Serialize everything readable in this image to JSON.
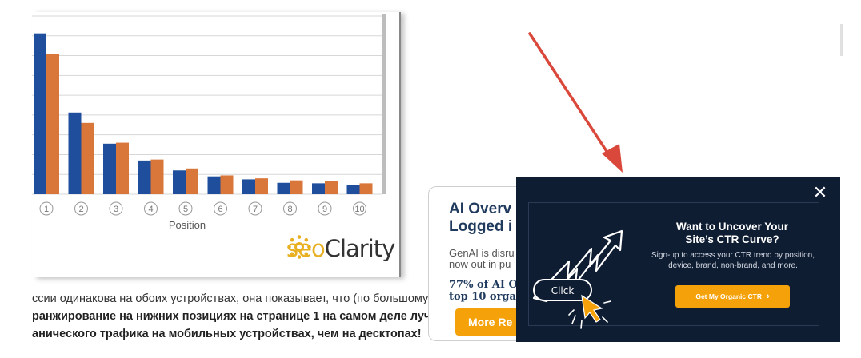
{
  "chart_data": {
    "type": "bar",
    "categories": [
      "1",
      "2",
      "3",
      "4",
      "5",
      "6",
      "7",
      "8",
      "9",
      "10"
    ],
    "series": [
      {
        "color": "#1f4e9c",
        "values": [
          32.5,
          16.5,
          10.2,
          6.8,
          4.8,
          3.6,
          3.0,
          2.3,
          2.2,
          1.9
        ]
      },
      {
        "color": "#d9763a",
        "values": [
          28.3,
          14.4,
          10.4,
          7.0,
          5.2,
          3.8,
          3.2,
          2.8,
          2.6,
          2.2
        ]
      }
    ],
    "xlabel": "Position",
    "ylabel": "",
    "ylim": [
      0,
      36
    ],
    "grid": true
  },
  "logo": {
    "seo": "seo",
    "clarity": "Clarity"
  },
  "article": {
    "line1": "ссии одинакова на обоих устройствах, она показывает, что (по большому",
    "line2": "ранжирование на нижних позициях на странице 1 на самом деле лучше",
    "line3": "анического трафика на мобильных устройствах, чем на десктопах!"
  },
  "promo": {
    "title_line1": "AI Overv",
    "title_line2": "Logged i",
    "body_line1": "GenAI is disru",
    "body_line2": "now out in pu",
    "stat_line1": "77% of AI O",
    "stat_line2": "top 10 organ",
    "button_label": "More Re"
  },
  "modal": {
    "close_label": "✕",
    "heading_line1": "Want to Uncover Your",
    "heading_line2": "Site’s CTR Curve?",
    "desc_line1": "Sign-up to access your CTR trend by position,",
    "desc_line2": "device, brand, non-brand, and more.",
    "button_label": "Get My Organic CTR",
    "button_chevron": "›",
    "click_label": "Click"
  },
  "colors": {
    "accent": "#f5a20a",
    "modal_bg": "#0f1d33",
    "arrow": "#d9483b"
  }
}
